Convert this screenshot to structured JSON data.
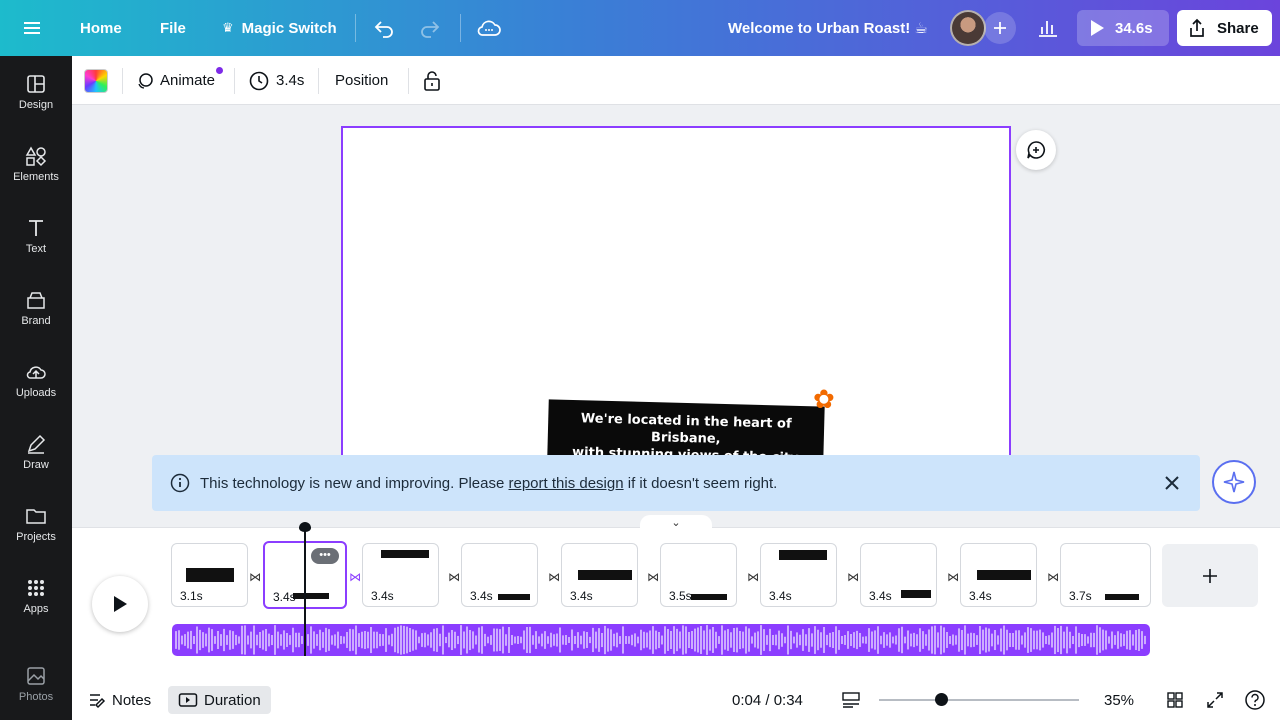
{
  "header": {
    "home": "Home",
    "file": "File",
    "magic_switch": "Magic Switch",
    "doc_title": "Welcome to Urban Roast! ☕",
    "play_duration": "34.6s",
    "share": "Share"
  },
  "sidebar": {
    "items": [
      {
        "label": "Design"
      },
      {
        "label": "Elements"
      },
      {
        "label": "Text"
      },
      {
        "label": "Brand"
      },
      {
        "label": "Uploads"
      },
      {
        "label": "Draw"
      },
      {
        "label": "Projects"
      },
      {
        "label": "Apps"
      },
      {
        "label": "Photos"
      }
    ]
  },
  "toolbar": {
    "animate": "Animate",
    "duration": "3.4s",
    "position": "Position"
  },
  "canvas": {
    "caption_line1": "We're located in the heart of Brisbane,",
    "caption_line2": "with stunning views of the city skyline"
  },
  "banner": {
    "text_before": "This technology is new and improving. Please ",
    "link": "report this design",
    "text_after": " if it doesn't seem right."
  },
  "timeline": {
    "pages": [
      {
        "duration": "3.1s"
      },
      {
        "duration": "3.4s"
      },
      {
        "duration": "3.4s"
      },
      {
        "duration": "3.4s"
      },
      {
        "duration": "3.4s"
      },
      {
        "duration": "3.5s"
      },
      {
        "duration": "3.4s"
      },
      {
        "duration": "3.4s"
      },
      {
        "duration": "3.4s"
      },
      {
        "duration": "3.7s"
      }
    ],
    "selected_page": 2,
    "thumb1_title": "Welcome to Urban Roast! ☕"
  },
  "footer": {
    "notes": "Notes",
    "duration": "Duration",
    "time": "0:04 / 0:34",
    "zoom": "35%"
  },
  "colors": {
    "accent": "#8b3dff",
    "sidebar_bg": "#18191b",
    "banner_bg": "#cde4fb"
  }
}
